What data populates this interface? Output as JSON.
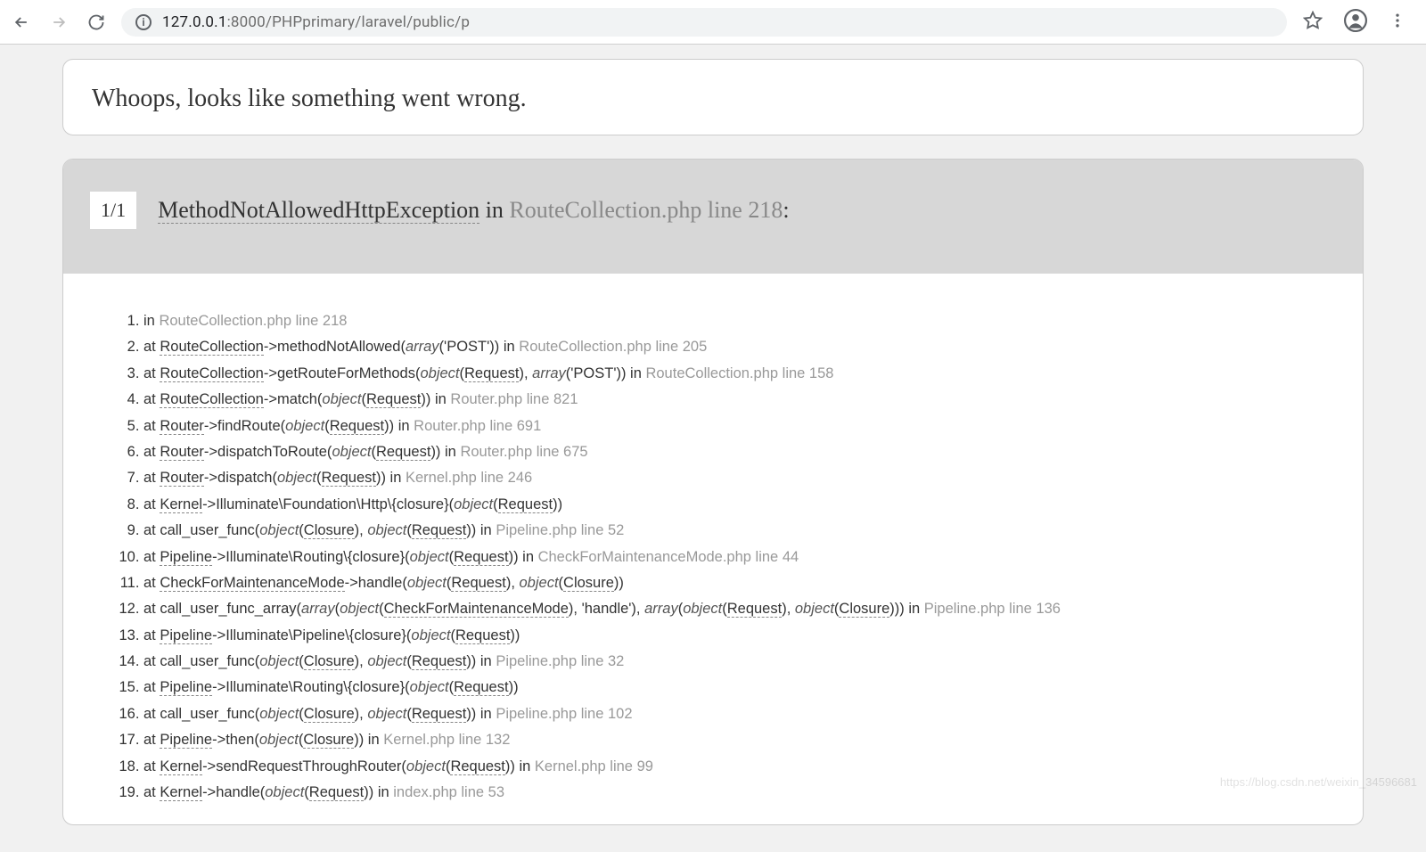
{
  "browser": {
    "url_host": "127.0.0.1",
    "url_port_path": ":8000/PHPprimary/laravel/public/p"
  },
  "whoops": {
    "title": "Whoops, looks like something went wrong."
  },
  "error": {
    "counter": "1/1",
    "exception": "MethodNotAllowedHttpException",
    "in_word": " in ",
    "file_ref": "RouteCollection.php line 218",
    "colon": ":"
  },
  "trace": [
    {
      "parts": [
        {
          "t": "in ",
          "c": ""
        },
        {
          "t": "RouteCollection.php line 218",
          "c": "faded"
        }
      ]
    },
    {
      "parts": [
        {
          "t": "at ",
          "c": ""
        },
        {
          "t": "RouteCollection",
          "c": "dashed"
        },
        {
          "t": "->methodNotAllowed(",
          "c": ""
        },
        {
          "t": "array",
          "c": "italic"
        },
        {
          "t": "('POST')) in ",
          "c": ""
        },
        {
          "t": "RouteCollection.php line 205",
          "c": "faded"
        }
      ]
    },
    {
      "parts": [
        {
          "t": "at ",
          "c": ""
        },
        {
          "t": "RouteCollection",
          "c": "dashed"
        },
        {
          "t": "->getRouteForMethods(",
          "c": ""
        },
        {
          "t": "object",
          "c": "italic"
        },
        {
          "t": "(",
          "c": ""
        },
        {
          "t": "Request",
          "c": "dashed"
        },
        {
          "t": "), ",
          "c": ""
        },
        {
          "t": "array",
          "c": "italic"
        },
        {
          "t": "('POST')) in ",
          "c": ""
        },
        {
          "t": "RouteCollection.php line 158",
          "c": "faded"
        }
      ]
    },
    {
      "parts": [
        {
          "t": "at ",
          "c": ""
        },
        {
          "t": "RouteCollection",
          "c": "dashed"
        },
        {
          "t": "->match(",
          "c": ""
        },
        {
          "t": "object",
          "c": "italic"
        },
        {
          "t": "(",
          "c": ""
        },
        {
          "t": "Request",
          "c": "dashed"
        },
        {
          "t": ")) in ",
          "c": ""
        },
        {
          "t": "Router.php line 821",
          "c": "faded"
        }
      ]
    },
    {
      "parts": [
        {
          "t": "at ",
          "c": ""
        },
        {
          "t": "Router",
          "c": "dashed"
        },
        {
          "t": "->findRoute(",
          "c": ""
        },
        {
          "t": "object",
          "c": "italic"
        },
        {
          "t": "(",
          "c": ""
        },
        {
          "t": "Request",
          "c": "dashed"
        },
        {
          "t": ")) in ",
          "c": ""
        },
        {
          "t": "Router.php line 691",
          "c": "faded"
        }
      ]
    },
    {
      "parts": [
        {
          "t": "at ",
          "c": ""
        },
        {
          "t": "Router",
          "c": "dashed"
        },
        {
          "t": "->dispatchToRoute(",
          "c": ""
        },
        {
          "t": "object",
          "c": "italic"
        },
        {
          "t": "(",
          "c": ""
        },
        {
          "t": "Request",
          "c": "dashed"
        },
        {
          "t": ")) in ",
          "c": ""
        },
        {
          "t": "Router.php line 675",
          "c": "faded"
        }
      ]
    },
    {
      "parts": [
        {
          "t": "at ",
          "c": ""
        },
        {
          "t": "Router",
          "c": "dashed"
        },
        {
          "t": "->dispatch(",
          "c": ""
        },
        {
          "t": "object",
          "c": "italic"
        },
        {
          "t": "(",
          "c": ""
        },
        {
          "t": "Request",
          "c": "dashed"
        },
        {
          "t": ")) in ",
          "c": ""
        },
        {
          "t": "Kernel.php line 246",
          "c": "faded"
        }
      ]
    },
    {
      "parts": [
        {
          "t": "at ",
          "c": ""
        },
        {
          "t": "Kernel",
          "c": "dashed"
        },
        {
          "t": "->Illuminate\\Foundation\\Http\\{closure}(",
          "c": ""
        },
        {
          "t": "object",
          "c": "italic"
        },
        {
          "t": "(",
          "c": ""
        },
        {
          "t": "Request",
          "c": "dashed"
        },
        {
          "t": "))",
          "c": ""
        }
      ]
    },
    {
      "parts": [
        {
          "t": "at call_user_func(",
          "c": ""
        },
        {
          "t": "object",
          "c": "italic"
        },
        {
          "t": "(",
          "c": ""
        },
        {
          "t": "Closure",
          "c": "dashed"
        },
        {
          "t": "), ",
          "c": ""
        },
        {
          "t": "object",
          "c": "italic"
        },
        {
          "t": "(",
          "c": ""
        },
        {
          "t": "Request",
          "c": "dashed"
        },
        {
          "t": ")) in ",
          "c": ""
        },
        {
          "t": "Pipeline.php line 52",
          "c": "faded"
        }
      ]
    },
    {
      "parts": [
        {
          "t": "at ",
          "c": ""
        },
        {
          "t": "Pipeline",
          "c": "dashed"
        },
        {
          "t": "->Illuminate\\Routing\\{closure}(",
          "c": ""
        },
        {
          "t": "object",
          "c": "italic"
        },
        {
          "t": "(",
          "c": ""
        },
        {
          "t": "Request",
          "c": "dashed"
        },
        {
          "t": ")) in ",
          "c": ""
        },
        {
          "t": "CheckForMaintenanceMode.php line 44",
          "c": "faded"
        }
      ]
    },
    {
      "parts": [
        {
          "t": "at ",
          "c": ""
        },
        {
          "t": "CheckForMaintenanceMode",
          "c": "dashed"
        },
        {
          "t": "->handle(",
          "c": ""
        },
        {
          "t": "object",
          "c": "italic"
        },
        {
          "t": "(",
          "c": ""
        },
        {
          "t": "Request",
          "c": "dashed"
        },
        {
          "t": "), ",
          "c": ""
        },
        {
          "t": "object",
          "c": "italic"
        },
        {
          "t": "(",
          "c": ""
        },
        {
          "t": "Closure",
          "c": "dashed"
        },
        {
          "t": "))",
          "c": ""
        }
      ]
    },
    {
      "parts": [
        {
          "t": "at call_user_func_array(",
          "c": ""
        },
        {
          "t": "array",
          "c": "italic"
        },
        {
          "t": "(",
          "c": ""
        },
        {
          "t": "object",
          "c": "italic"
        },
        {
          "t": "(",
          "c": ""
        },
        {
          "t": "CheckForMaintenanceMode",
          "c": "dashed"
        },
        {
          "t": "), 'handle'), ",
          "c": ""
        },
        {
          "t": "array",
          "c": "italic"
        },
        {
          "t": "(",
          "c": ""
        },
        {
          "t": "object",
          "c": "italic"
        },
        {
          "t": "(",
          "c": ""
        },
        {
          "t": "Request",
          "c": "dashed"
        },
        {
          "t": "), ",
          "c": ""
        },
        {
          "t": "object",
          "c": "italic"
        },
        {
          "t": "(",
          "c": ""
        },
        {
          "t": "Closure",
          "c": "dashed"
        },
        {
          "t": "))) in ",
          "c": ""
        },
        {
          "t": "Pipeline.php line 136",
          "c": "faded"
        }
      ]
    },
    {
      "parts": [
        {
          "t": "at ",
          "c": ""
        },
        {
          "t": "Pipeline",
          "c": "dashed"
        },
        {
          "t": "->Illuminate\\Pipeline\\{closure}(",
          "c": ""
        },
        {
          "t": "object",
          "c": "italic"
        },
        {
          "t": "(",
          "c": ""
        },
        {
          "t": "Request",
          "c": "dashed"
        },
        {
          "t": "))",
          "c": ""
        }
      ]
    },
    {
      "parts": [
        {
          "t": "at call_user_func(",
          "c": ""
        },
        {
          "t": "object",
          "c": "italic"
        },
        {
          "t": "(",
          "c": ""
        },
        {
          "t": "Closure",
          "c": "dashed"
        },
        {
          "t": "), ",
          "c": ""
        },
        {
          "t": "object",
          "c": "italic"
        },
        {
          "t": "(",
          "c": ""
        },
        {
          "t": "Request",
          "c": "dashed"
        },
        {
          "t": ")) in ",
          "c": ""
        },
        {
          "t": "Pipeline.php line 32",
          "c": "faded"
        }
      ]
    },
    {
      "parts": [
        {
          "t": "at ",
          "c": ""
        },
        {
          "t": "Pipeline",
          "c": "dashed"
        },
        {
          "t": "->Illuminate\\Routing\\{closure}(",
          "c": ""
        },
        {
          "t": "object",
          "c": "italic"
        },
        {
          "t": "(",
          "c": ""
        },
        {
          "t": "Request",
          "c": "dashed"
        },
        {
          "t": "))",
          "c": ""
        }
      ]
    },
    {
      "parts": [
        {
          "t": "at call_user_func(",
          "c": ""
        },
        {
          "t": "object",
          "c": "italic"
        },
        {
          "t": "(",
          "c": ""
        },
        {
          "t": "Closure",
          "c": "dashed"
        },
        {
          "t": "), ",
          "c": ""
        },
        {
          "t": "object",
          "c": "italic"
        },
        {
          "t": "(",
          "c": ""
        },
        {
          "t": "Request",
          "c": "dashed"
        },
        {
          "t": ")) in ",
          "c": ""
        },
        {
          "t": "Pipeline.php line 102",
          "c": "faded"
        }
      ]
    },
    {
      "parts": [
        {
          "t": "at ",
          "c": ""
        },
        {
          "t": "Pipeline",
          "c": "dashed"
        },
        {
          "t": "->then(",
          "c": ""
        },
        {
          "t": "object",
          "c": "italic"
        },
        {
          "t": "(",
          "c": ""
        },
        {
          "t": "Closure",
          "c": "dashed"
        },
        {
          "t": ")) in ",
          "c": ""
        },
        {
          "t": "Kernel.php line 132",
          "c": "faded"
        }
      ]
    },
    {
      "parts": [
        {
          "t": "at ",
          "c": ""
        },
        {
          "t": "Kernel",
          "c": "dashed"
        },
        {
          "t": "->sendRequestThroughRouter(",
          "c": ""
        },
        {
          "t": "object",
          "c": "italic"
        },
        {
          "t": "(",
          "c": ""
        },
        {
          "t": "Request",
          "c": "dashed"
        },
        {
          "t": ")) in ",
          "c": ""
        },
        {
          "t": "Kernel.php line 99",
          "c": "faded"
        }
      ]
    },
    {
      "parts": [
        {
          "t": "at ",
          "c": ""
        },
        {
          "t": "Kernel",
          "c": "dashed"
        },
        {
          "t": "->handle(",
          "c": ""
        },
        {
          "t": "object",
          "c": "italic"
        },
        {
          "t": "(",
          "c": ""
        },
        {
          "t": "Request",
          "c": "dashed"
        },
        {
          "t": ")) in ",
          "c": ""
        },
        {
          "t": "index.php line 53",
          "c": "faded"
        }
      ]
    }
  ],
  "watermark": "https://blog.csdn.net/weixin_34596681"
}
